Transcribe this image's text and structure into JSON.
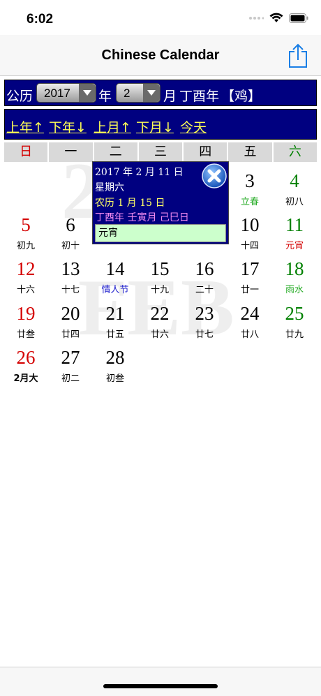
{
  "status_bar": {
    "time": "6:02"
  },
  "nav": {
    "title": "Chinese Calendar"
  },
  "year_bar": {
    "gongli": "公历",
    "year_value": "2017",
    "year_suffix": "年",
    "month_value": "2",
    "month_suffix": "月",
    "ganzhi": "丁酉年",
    "zodiac": "【鸡】"
  },
  "nav_links": {
    "prev_year": "上年↑",
    "next_year": "下年↓",
    "prev_month": "上月↑",
    "next_month": "下月↓",
    "today": "今天"
  },
  "weekdays": [
    "日",
    "一",
    "二",
    "三",
    "四",
    "五",
    "六"
  ],
  "watermark": {
    "year": "2017",
    "month": "FEB"
  },
  "days": [
    {
      "day": "3",
      "lunar": "立春"
    },
    {
      "day": "4",
      "lunar": "初八"
    },
    {
      "day": "5",
      "lunar": "初九"
    },
    {
      "day": "6",
      "lunar": "初十"
    },
    {
      "day": "10",
      "lunar": "十四"
    },
    {
      "day": "11",
      "lunar": "元宵"
    },
    {
      "day": "12",
      "lunar": "十六"
    },
    {
      "day": "13",
      "lunar": "十七"
    },
    {
      "day": "14",
      "lunar": "情人节"
    },
    {
      "day": "15",
      "lunar": "十九"
    },
    {
      "day": "16",
      "lunar": "二十"
    },
    {
      "day": "17",
      "lunar": "廿一"
    },
    {
      "day": "18",
      "lunar": "雨水"
    },
    {
      "day": "19",
      "lunar": "廿叁"
    },
    {
      "day": "20",
      "lunar": "廿四"
    },
    {
      "day": "21",
      "lunar": "廿五"
    },
    {
      "day": "22",
      "lunar": "廿六"
    },
    {
      "day": "23",
      "lunar": "廿七"
    },
    {
      "day": "24",
      "lunar": "廿八"
    },
    {
      "day": "25",
      "lunar": "廿九"
    },
    {
      "day": "26",
      "lunar": "2月大"
    },
    {
      "day": "27",
      "lunar": "初二"
    },
    {
      "day": "28",
      "lunar": "初叁"
    }
  ],
  "popup": {
    "date": "2017 年 2 月 11 日",
    "weekday": "星期六",
    "lunar": "农历 1 月 15 日",
    "ganzhi": "丁酉年 壬寅月 己巳日",
    "note": "元宵"
  },
  "colors": {
    "bar_bg": "#000080",
    "link": "#ffff55",
    "sunday": "#d40000",
    "saturday": "#008000",
    "solar_term": "#22aa22",
    "festival": "#1a1acc",
    "holiday": "#d40000",
    "popup_lunar": "#ffff66",
    "popup_ganzhi": "#ee88ee"
  }
}
